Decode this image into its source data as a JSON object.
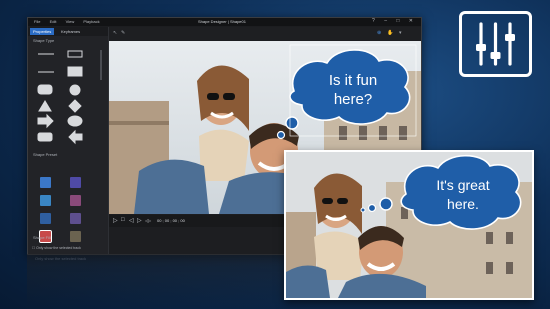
{
  "window": {
    "menu": [
      "File",
      "Edit",
      "View",
      "Playback"
    ],
    "title": "Shape Designer | Shape01",
    "controls": "? – □ ✕"
  },
  "left_panel": {
    "tabs": [
      "Properties",
      "Keyframes"
    ],
    "shape_type_label": "Shape Type",
    "shape_preset_label": "Shape Preset",
    "shape_fill_label": "Shape Fill",
    "only_selected_label": "Only show the selected track",
    "reflection_text": "Only show the selected track"
  },
  "preview": {
    "bubble_text_line1": "Is it fun",
    "bubble_text_line2": "here?"
  },
  "playback": {
    "controls": [
      "▷",
      "□",
      "◁",
      "▷",
      "◁▷",
      "▷▷"
    ],
    "timecode": "00 ; 00 ; 00 ; 00"
  },
  "result_card": {
    "bubble_text_line1": "It's great",
    "bubble_text_line2": "here."
  },
  "colors": {
    "accent": "#2b6cc4",
    "bubble_fill": "#1f5ea8",
    "background": "#0e2f57"
  },
  "icons": [
    "sliders-icon",
    "play-icon",
    "stop-icon",
    "prev-frame-icon",
    "next-frame-icon",
    "fullscreen-icon"
  ]
}
